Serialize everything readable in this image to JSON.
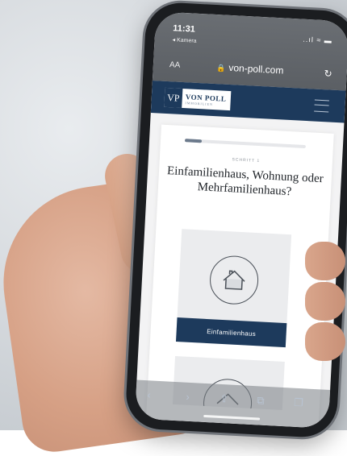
{
  "status": {
    "time": "11:31",
    "back_app": "◂ Kamera",
    "icons": "..ıl ≈ ▬"
  },
  "browser": {
    "aa": "AA",
    "url": "von-poll.com"
  },
  "brand": {
    "monogram": "VP",
    "name": "VON POLL",
    "tagline": "IMMOBILIEN",
    "color": "#1d3a5c"
  },
  "wizard": {
    "progress": 0.14,
    "step_label": "SCHRITT 1",
    "question": "Einfamilienhaus, Wohnung oder Mehrfamilienhaus?",
    "options": [
      {
        "label": "Einfamilienhaus",
        "icon": "house-icon"
      },
      {
        "label": "",
        "icon": "house-icon"
      }
    ]
  },
  "toolbar": [
    "back-icon",
    "forward-icon",
    "share-icon",
    "bookmarks-icon",
    "tabs-icon"
  ]
}
